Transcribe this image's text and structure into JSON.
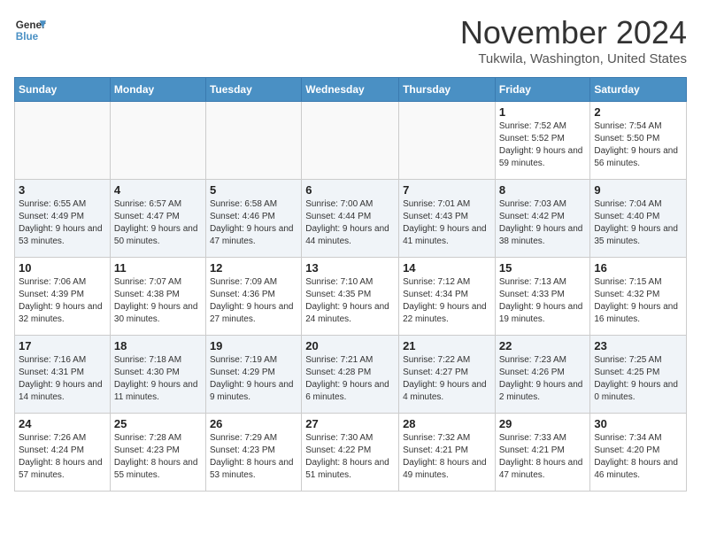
{
  "header": {
    "logo_line1": "General",
    "logo_line2": "Blue",
    "month_title": "November 2024",
    "location": "Tukwila, Washington, United States"
  },
  "weekdays": [
    "Sunday",
    "Monday",
    "Tuesday",
    "Wednesday",
    "Thursday",
    "Friday",
    "Saturday"
  ],
  "weeks": [
    [
      {
        "day": "",
        "info": ""
      },
      {
        "day": "",
        "info": ""
      },
      {
        "day": "",
        "info": ""
      },
      {
        "day": "",
        "info": ""
      },
      {
        "day": "",
        "info": ""
      },
      {
        "day": "1",
        "info": "Sunrise: 7:52 AM\nSunset: 5:52 PM\nDaylight: 9 hours and 59 minutes."
      },
      {
        "day": "2",
        "info": "Sunrise: 7:54 AM\nSunset: 5:50 PM\nDaylight: 9 hours and 56 minutes."
      }
    ],
    [
      {
        "day": "3",
        "info": "Sunrise: 6:55 AM\nSunset: 4:49 PM\nDaylight: 9 hours and 53 minutes."
      },
      {
        "day": "4",
        "info": "Sunrise: 6:57 AM\nSunset: 4:47 PM\nDaylight: 9 hours and 50 minutes."
      },
      {
        "day": "5",
        "info": "Sunrise: 6:58 AM\nSunset: 4:46 PM\nDaylight: 9 hours and 47 minutes."
      },
      {
        "day": "6",
        "info": "Sunrise: 7:00 AM\nSunset: 4:44 PM\nDaylight: 9 hours and 44 minutes."
      },
      {
        "day": "7",
        "info": "Sunrise: 7:01 AM\nSunset: 4:43 PM\nDaylight: 9 hours and 41 minutes."
      },
      {
        "day": "8",
        "info": "Sunrise: 7:03 AM\nSunset: 4:42 PM\nDaylight: 9 hours and 38 minutes."
      },
      {
        "day": "9",
        "info": "Sunrise: 7:04 AM\nSunset: 4:40 PM\nDaylight: 9 hours and 35 minutes."
      }
    ],
    [
      {
        "day": "10",
        "info": "Sunrise: 7:06 AM\nSunset: 4:39 PM\nDaylight: 9 hours and 32 minutes."
      },
      {
        "day": "11",
        "info": "Sunrise: 7:07 AM\nSunset: 4:38 PM\nDaylight: 9 hours and 30 minutes."
      },
      {
        "day": "12",
        "info": "Sunrise: 7:09 AM\nSunset: 4:36 PM\nDaylight: 9 hours and 27 minutes."
      },
      {
        "day": "13",
        "info": "Sunrise: 7:10 AM\nSunset: 4:35 PM\nDaylight: 9 hours and 24 minutes."
      },
      {
        "day": "14",
        "info": "Sunrise: 7:12 AM\nSunset: 4:34 PM\nDaylight: 9 hours and 22 minutes."
      },
      {
        "day": "15",
        "info": "Sunrise: 7:13 AM\nSunset: 4:33 PM\nDaylight: 9 hours and 19 minutes."
      },
      {
        "day": "16",
        "info": "Sunrise: 7:15 AM\nSunset: 4:32 PM\nDaylight: 9 hours and 16 minutes."
      }
    ],
    [
      {
        "day": "17",
        "info": "Sunrise: 7:16 AM\nSunset: 4:31 PM\nDaylight: 9 hours and 14 minutes."
      },
      {
        "day": "18",
        "info": "Sunrise: 7:18 AM\nSunset: 4:30 PM\nDaylight: 9 hours and 11 minutes."
      },
      {
        "day": "19",
        "info": "Sunrise: 7:19 AM\nSunset: 4:29 PM\nDaylight: 9 hours and 9 minutes."
      },
      {
        "day": "20",
        "info": "Sunrise: 7:21 AM\nSunset: 4:28 PM\nDaylight: 9 hours and 6 minutes."
      },
      {
        "day": "21",
        "info": "Sunrise: 7:22 AM\nSunset: 4:27 PM\nDaylight: 9 hours and 4 minutes."
      },
      {
        "day": "22",
        "info": "Sunrise: 7:23 AM\nSunset: 4:26 PM\nDaylight: 9 hours and 2 minutes."
      },
      {
        "day": "23",
        "info": "Sunrise: 7:25 AM\nSunset: 4:25 PM\nDaylight: 9 hours and 0 minutes."
      }
    ],
    [
      {
        "day": "24",
        "info": "Sunrise: 7:26 AM\nSunset: 4:24 PM\nDaylight: 8 hours and 57 minutes."
      },
      {
        "day": "25",
        "info": "Sunrise: 7:28 AM\nSunset: 4:23 PM\nDaylight: 8 hours and 55 minutes."
      },
      {
        "day": "26",
        "info": "Sunrise: 7:29 AM\nSunset: 4:23 PM\nDaylight: 8 hours and 53 minutes."
      },
      {
        "day": "27",
        "info": "Sunrise: 7:30 AM\nSunset: 4:22 PM\nDaylight: 8 hours and 51 minutes."
      },
      {
        "day": "28",
        "info": "Sunrise: 7:32 AM\nSunset: 4:21 PM\nDaylight: 8 hours and 49 minutes."
      },
      {
        "day": "29",
        "info": "Sunrise: 7:33 AM\nSunset: 4:21 PM\nDaylight: 8 hours and 47 minutes."
      },
      {
        "day": "30",
        "info": "Sunrise: 7:34 AM\nSunset: 4:20 PM\nDaylight: 8 hours and 46 minutes."
      }
    ]
  ]
}
